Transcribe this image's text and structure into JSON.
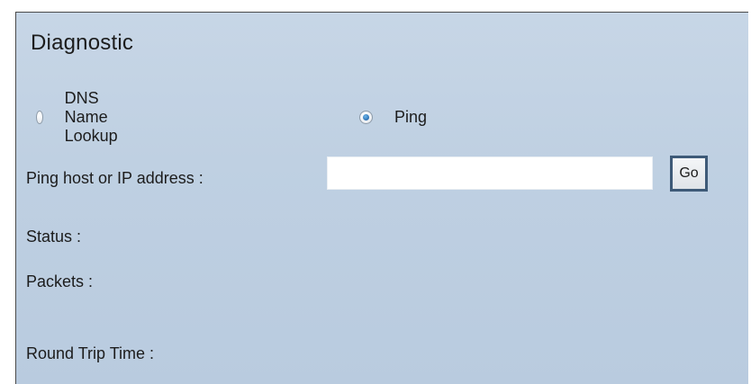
{
  "section": {
    "title": "Diagnostic"
  },
  "mode": {
    "options": [
      {
        "label": "DNS Name Lookup",
        "checked": false
      },
      {
        "label": "Ping",
        "checked": true
      }
    ]
  },
  "host": {
    "label": "Ping host or IP address :",
    "value": "",
    "go_label": "Go"
  },
  "results": {
    "status_label": "Status :",
    "packets_label": "Packets :",
    "round_trip_label": "Round Trip Time :"
  },
  "colors": {
    "panel_background": "#bfd0e2",
    "go_button_border": "#3e5a78",
    "radio_checked": "#2a6fb2"
  }
}
